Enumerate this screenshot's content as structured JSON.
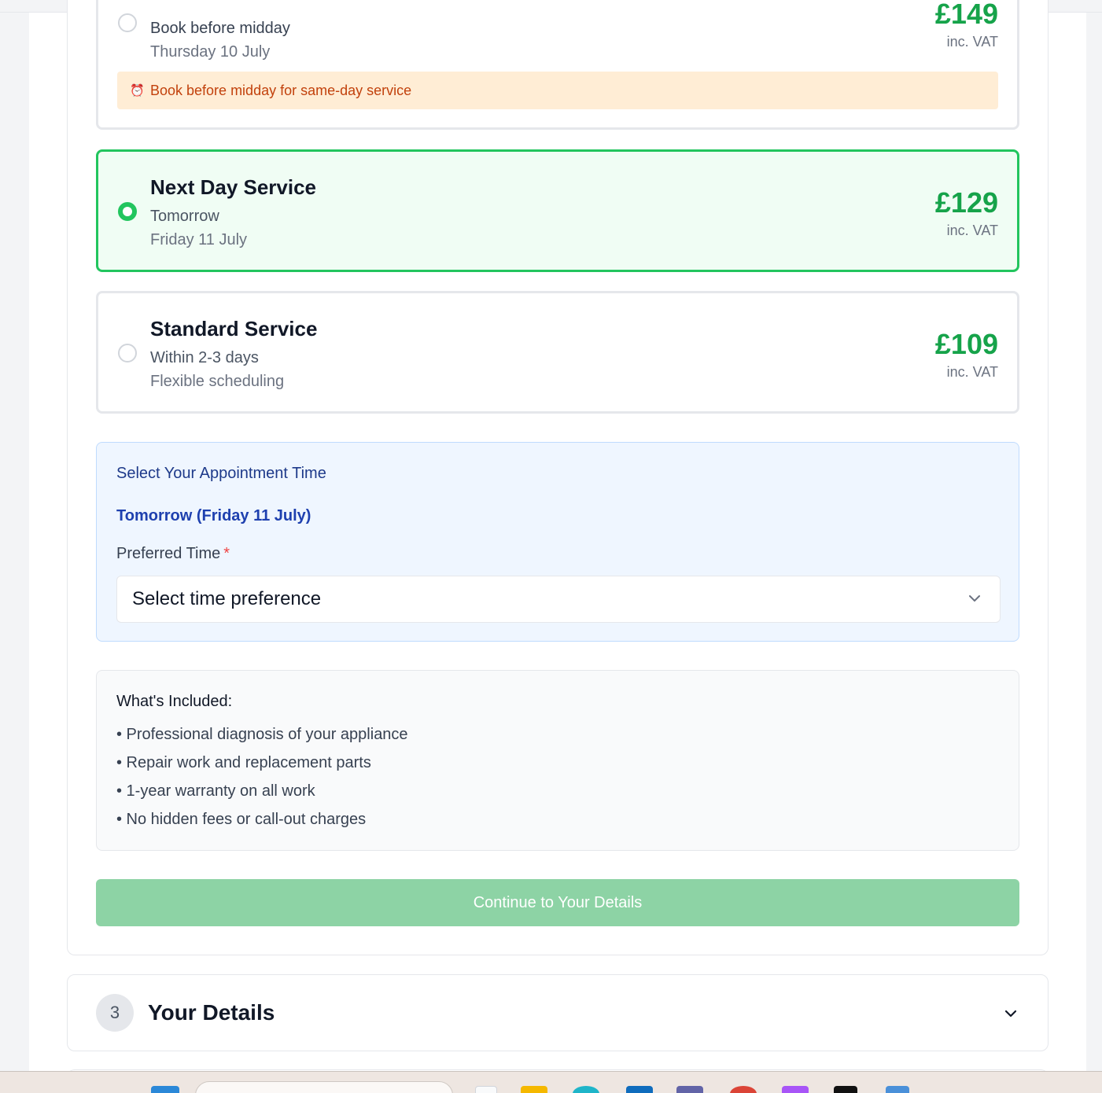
{
  "service_options": [
    {
      "title": "",
      "line1": "Book before midday",
      "line2": "Thursday 10 July",
      "price": "£149",
      "vat": "inc. VAT",
      "selected": false,
      "notice": "Book before midday for same-day service",
      "notice_icon": "alarm-clock-icon"
    },
    {
      "title": "Next Day Service",
      "line1": "Tomorrow",
      "line2": "Friday 11 July",
      "price": "£129",
      "vat": "inc. VAT",
      "selected": true
    },
    {
      "title": "Standard Service",
      "line1": "Within 2-3 days",
      "line2": "Flexible scheduling",
      "price": "£109",
      "vat": "inc. VAT",
      "selected": false
    }
  ],
  "appointment": {
    "title": "Select Your Appointment Time",
    "date": "Tomorrow (Friday 11 July)",
    "preferred_label": "Preferred Time",
    "required_mark": "*",
    "select_value": "Select time preference"
  },
  "included": {
    "title": "What's Included:",
    "items": [
      "• Professional diagnosis of your appliance",
      "• Repair work and replacement parts",
      "• 1-year warranty on all work",
      "• No hidden fees or call-out charges"
    ]
  },
  "continue_label": "Continue to Your Details",
  "details_step": {
    "number": "3",
    "title": "Your Details"
  },
  "colors": {
    "accent_green": "#16a34a",
    "selected_border": "#22c55e",
    "selected_bg": "#f0fdf4",
    "notice_bg": "#ffedd5",
    "notice_text": "#c2410c",
    "appointment_bg": "#eff6ff",
    "continue_disabled": "#8dd3a5"
  },
  "taskbar": {
    "icons": [
      "windows-start-icon",
      "search-box",
      "file-icon",
      "folder-icon",
      "edge-icon",
      "outlook-icon",
      "teams-icon",
      "chrome-icon",
      "app-icon",
      "terminal-icon",
      "calendar-icon"
    ]
  }
}
